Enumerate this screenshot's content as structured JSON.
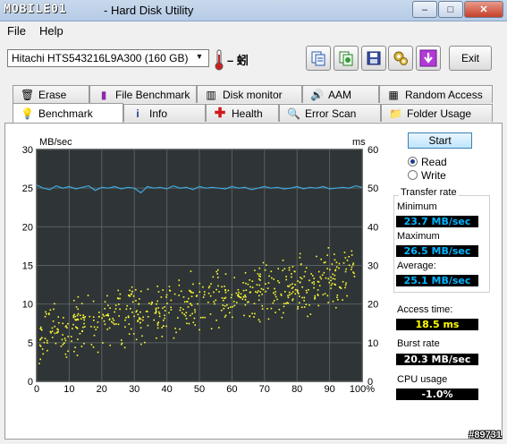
{
  "window": {
    "brand": "MOBILE01",
    "title": "- Hard Disk Utility",
    "controls": [
      "–",
      "□",
      "✕"
    ]
  },
  "menu": [
    "File",
    "Help"
  ],
  "drive": {
    "selected": "Hitachi HTS543216L9A300 (160 GB)"
  },
  "temperature": "– 蚓",
  "toolbar": {
    "exit_label": "Exit"
  },
  "tabs_row1": [
    {
      "label": "Erase",
      "icon": "trash-icon"
    },
    {
      "label": "File Benchmark",
      "icon": "file-benchmark-icon"
    },
    {
      "label": "Disk monitor",
      "icon": "disk-monitor-icon"
    },
    {
      "label": "AAM",
      "icon": "speaker-icon"
    },
    {
      "label": "Random Access",
      "icon": "random-access-icon"
    }
  ],
  "tabs_row2": [
    {
      "label": "Benchmark",
      "icon": "lightbulb-icon",
      "active": true
    },
    {
      "label": "Info",
      "icon": "info-icon"
    },
    {
      "label": "Health",
      "icon": "health-cross-icon"
    },
    {
      "label": "Error Scan",
      "icon": "magnifier-icon"
    },
    {
      "label": "Folder Usage",
      "icon": "folder-icon"
    }
  ],
  "controls": {
    "start_label": "Start",
    "mode_read": "Read",
    "mode_write": "Write",
    "mode_selected": "Read"
  },
  "stats": {
    "transfer_rate_title": "Transfer rate",
    "minimum_label": "Minimum",
    "minimum_value": "23.7 MB/sec",
    "maximum_label": "Maximum",
    "maximum_value": "26.5 MB/sec",
    "average_label": "Average:",
    "average_value": "25.1 MB/sec",
    "access_label": "Access time:",
    "access_value": "18.5 ms",
    "burst_label": "Burst rate",
    "burst_value": "20.3 MB/sec",
    "cpu_label": "CPU usage",
    "cpu_value": "-1.0%"
  },
  "watermark": "#89731",
  "chart_data": {
    "type": "line",
    "ylabel_left": "MB/sec",
    "ylabel_right": "ms",
    "ylim_left": [
      0,
      30
    ],
    "ylim_right": [
      0,
      60
    ],
    "xlim": [
      0,
      100
    ],
    "yticks_left": [
      "0",
      "5",
      "10",
      "15",
      "20",
      "25",
      "30"
    ],
    "yticks_right": [
      "0",
      "10",
      "20",
      "30",
      "40",
      "50",
      "60"
    ],
    "xticks": [
      "0",
      "10",
      "20",
      "30",
      "40",
      "50",
      "60",
      "70",
      "80",
      "90",
      "100%"
    ],
    "grid": true,
    "series": [
      {
        "color": "#3da9e0",
        "x": [
          0,
          2,
          4,
          6,
          8,
          10,
          12,
          14,
          16,
          18,
          20,
          22,
          24,
          26,
          28,
          30,
          32,
          34,
          36,
          38,
          40,
          42,
          44,
          46,
          48,
          50,
          52,
          54,
          56,
          58,
          60,
          62,
          64,
          66,
          68,
          70,
          72,
          74,
          76,
          78,
          80,
          82,
          84,
          86,
          88,
          90,
          92,
          94,
          96,
          98,
          100
        ],
        "values": [
          25.4,
          25.0,
          24.8,
          25.3,
          25.0,
          25.2,
          24.9,
          25.1,
          25.3,
          24.7,
          25.1,
          25.0,
          25.2,
          24.9,
          25.1,
          25.0,
          24.4,
          25.2,
          25.0,
          25.1,
          24.9,
          25.3,
          25.0,
          25.1,
          24.8,
          25.2,
          25.0,
          25.1,
          25.0,
          24.9,
          25.2,
          25.0,
          25.1,
          24.8,
          25.0,
          25.2,
          25.0,
          25.1,
          24.9,
          25.0,
          25.2,
          24.9,
          25.1,
          25.0,
          25.2,
          24.9,
          25.0,
          25.1,
          25.0,
          25.3,
          25.1
        ]
      },
      {
        "color": "#ffff33",
        "type": "scatter",
        "trend_start_ms": 13,
        "trend_end_ms": 28,
        "spread_ms": 9
      }
    ]
  }
}
